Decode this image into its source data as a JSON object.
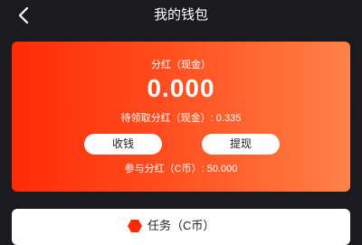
{
  "header": {
    "title": "我的钱包",
    "back_icon": "chevron-left-icon"
  },
  "wallet": {
    "dividend_label": "分红（现金）",
    "dividend_amount": "0.000",
    "pending_text": "待领取分红（现金）: 0.335",
    "collect_label": "收钱",
    "withdraw_label": "提现",
    "participate_text": "参与分红（C币）: 50.000",
    "gradient_colors": [
      "#ff2b05",
      "#ff8246"
    ]
  },
  "bottom_card": {
    "label": "任务（C币）",
    "icon": "task-icon",
    "icon_color": "#ff2b05"
  }
}
